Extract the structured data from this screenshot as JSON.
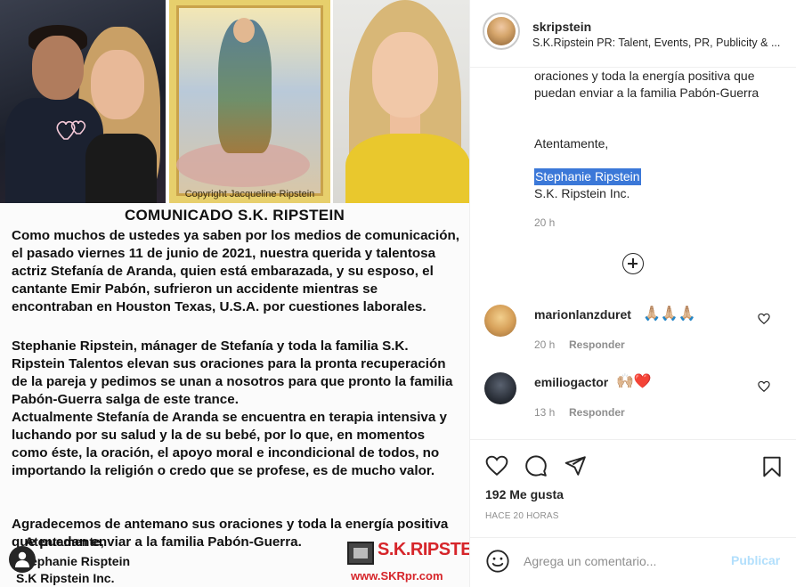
{
  "post_image": {
    "copyright": "Copyright Jacqueline Ripstein",
    "title": "COMUNICADO S.K. RIPSTEIN",
    "paragraphs": [
      "Como muchos de ustedes ya saben por los medios de comunicación, el pasado viernes 11 de junio de 2021, nuestra querida y talentosa actriz Stefanía de Aranda, quien está embarazada, y su esposo, el cantante Emir Pabón, sufrieron un accidente mientras se encontraban en Houston Texas, U.S.A. por cuestiones laborales.",
      "Stephanie Ripstein, mánager de Stefanía y toda la familia S.K. Ripstein Talentos elevan sus oraciones para la pronta recuperación de la pareja y pedimos se unan a nosotros para que pronto la familia Pabón-Guerra salga de este trance.",
      "Actualmente Stefanía de Aranda se encuentra en terapia intensiva y luchando por su salud y la de su bebé, por lo que, en momentos como éste, la oración, el apoyo moral e incondicional de todos, no importando la religión o credo que se profese, es de mucho valor.",
      "Agradecemos de antemano sus oraciones y toda la energía positiva que puedan enviar a la familia Pabón-Guerra."
    ],
    "signature": [
      "Atentamente,",
      "Stephanie Risptein",
      "S.K Ripstein Inc."
    ],
    "logo_text": "S.K.RIPSTEIN",
    "website": "www.SKRpr.com"
  },
  "header": {
    "username": "skripstein",
    "subtitle": "S.K.Ripstein PR: Talent, Events, PR, Publicity & ..."
  },
  "caption": {
    "text": "oraciones y toda la energía positiva que puedan enviar a la familia Pabón-Guerra",
    "regards": "Atentamente,",
    "name": "Stephanie Ripstein",
    "company": "S.K. Ripstein Inc.",
    "time": "20 h"
  },
  "comments": [
    {
      "user": "marionlanzduret",
      "emoji": "🙏🏼🙏🏼🙏🏼",
      "time": "20 h",
      "reply": "Responder"
    },
    {
      "user": "emiliogactor",
      "emoji": "🙌🏼❤️",
      "time": "13 h",
      "reply": "Responder"
    }
  ],
  "actions": {
    "likes": "192 Me gusta",
    "age": "HACE 20 HORAS"
  },
  "comment_box": {
    "placeholder": "Agrega un comentario...",
    "publish": "Publicar"
  },
  "colors": {
    "selection": "#3b78d8",
    "brand_red": "#d6252a",
    "publish_disabled": "#b2dffc",
    "meta_gray": "#8e8e8e"
  }
}
